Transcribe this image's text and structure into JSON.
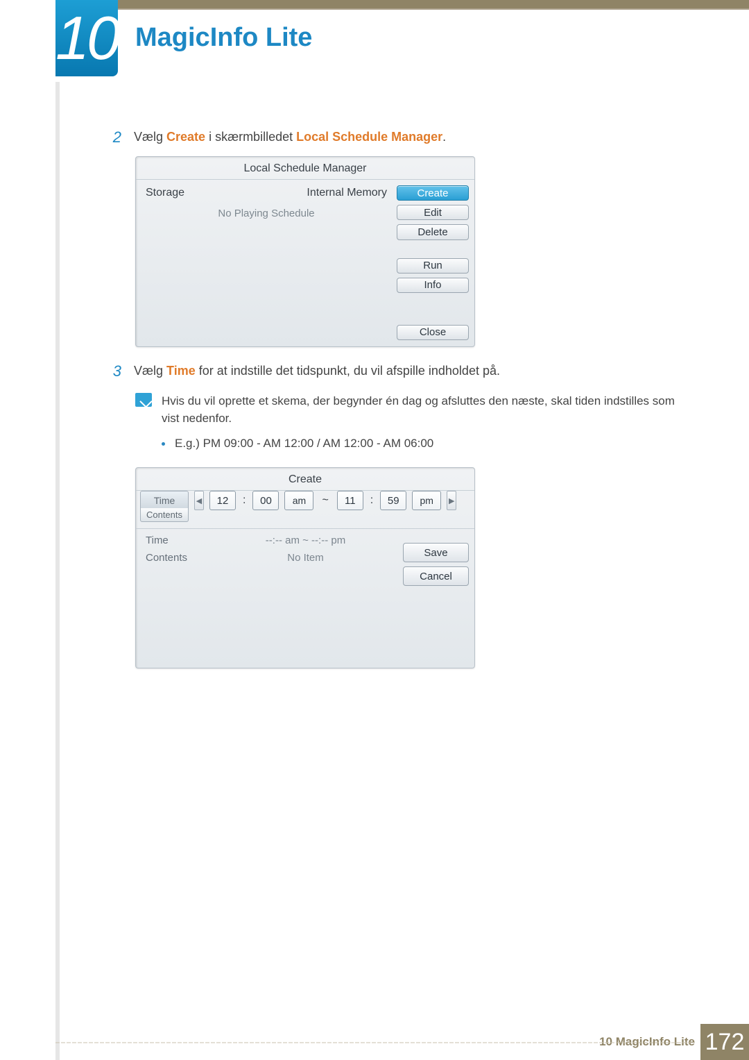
{
  "chapter": {
    "number": "10",
    "title": "MagicInfo Lite"
  },
  "steps": {
    "s2": {
      "num": "2",
      "pre": "Vælg ",
      "kw1": "Create",
      "mid": " i skærmbilledet ",
      "kw2": "Local Schedule Manager",
      "post": "."
    },
    "s3": {
      "num": "3",
      "pre": "Vælg ",
      "kw1": "Time",
      "post": " for at indstille det tidspunkt, du vil afspille indholdet på."
    }
  },
  "schedPanel": {
    "title": "Local Schedule Manager",
    "storageLabel": "Storage",
    "storageValue": "Internal Memory",
    "noPlaying": "No Playing Schedule",
    "buttons": {
      "create": "Create",
      "edit": "Edit",
      "delete": "Delete",
      "run": "Run",
      "info": "Info",
      "close": "Close"
    }
  },
  "note": {
    "text": "Hvis du vil oprette et skema, der begynder én dag og afsluttes den næste, skal tiden indstilles som vist nedenfor.",
    "example": "E.g.) PM 09:00 - AM 12:00 / AM 12:00 - AM 06:00"
  },
  "createPanel": {
    "title": "Create",
    "tabs": {
      "time": "Time",
      "contents": "Contents"
    },
    "time": {
      "h1": "12",
      "m1": "00",
      "ap1": "am",
      "h2": "11",
      "m2": "59",
      "ap2": "pm",
      "colon": ":",
      "tilde": "~"
    },
    "summary": {
      "timeLabel": "Time",
      "timeVal": "--:-- am ~ --:-- pm",
      "contentsLabel": "Contents",
      "contentsVal": "No Item"
    },
    "buttons": {
      "save": "Save",
      "cancel": "Cancel"
    }
  },
  "footer": {
    "text": "10 MagicInfo Lite",
    "page": "172"
  }
}
